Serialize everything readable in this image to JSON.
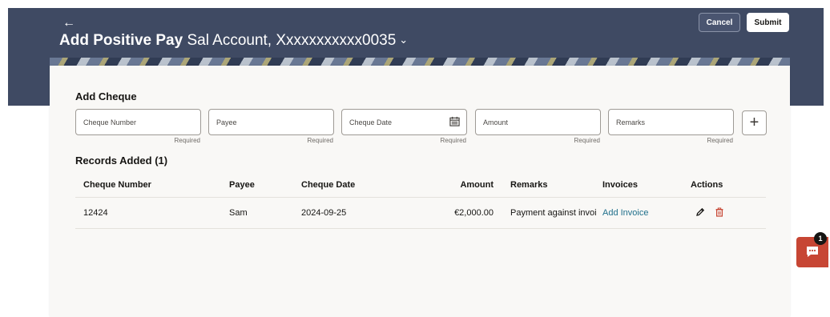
{
  "header": {
    "back_icon": "arrow-left-icon",
    "title_bold": "Add Positive Pay",
    "title_rest": "Sal Account, Xxxxxxxxxxx0035",
    "cancel_label": "Cancel",
    "submit_label": "Submit"
  },
  "add_cheque": {
    "title": "Add Cheque",
    "fields": [
      {
        "placeholder": "Cheque Number",
        "hint": "Required"
      },
      {
        "placeholder": "Payee",
        "hint": "Required"
      },
      {
        "placeholder": "Cheque Date",
        "hint": "Required",
        "icon": "calendar-icon"
      },
      {
        "placeholder": "Amount",
        "hint": "Required"
      },
      {
        "placeholder": "Remarks",
        "hint": "Required"
      }
    ],
    "add_icon": "plus-icon"
  },
  "records": {
    "title": "Records Added (1)",
    "columns": [
      "Cheque Number",
      "Payee",
      "Cheque Date",
      "Amount",
      "Remarks",
      "Invoices",
      "Actions"
    ],
    "rows": [
      {
        "cheque_number": "12424",
        "payee": "Sam",
        "cheque_date": "2024-09-25",
        "amount": "€2,000.00",
        "remarks": "Payment against invoi",
        "invoice_link": "Add Invoice"
      }
    ]
  },
  "chat": {
    "icon": "chat-icon",
    "badge_count": "1"
  },
  "colors": {
    "header_bg": "#3f4a63",
    "accent_red": "#c74634",
    "link": "#1f6f8b"
  }
}
